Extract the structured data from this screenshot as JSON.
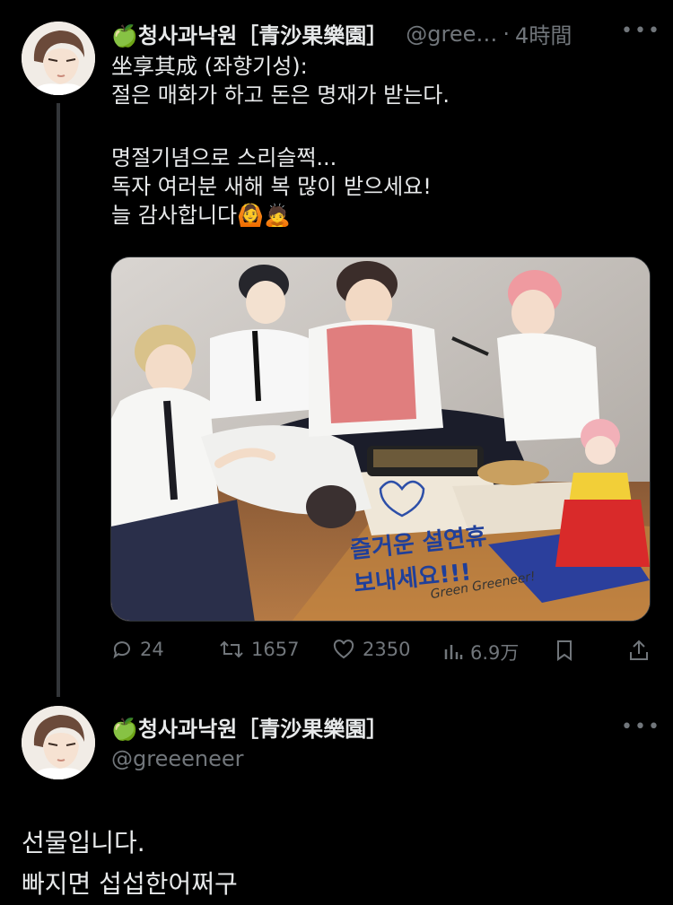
{
  "tweet": {
    "author_name": "🍏청사과낙원［青沙果樂園］",
    "handle": "@gree…",
    "separator": "·",
    "time": "4時間",
    "more": "•••",
    "lines": [
      "坐享其成 (좌향기성):",
      "절은 매화가 하고 돈은 명재가 받는다.",
      "",
      "명절기념으로 스리슬쩍...",
      "독자 여러분 새해 복 많이 받으세요!",
      "늘 감사합니다🙆🙇"
    ],
    "media": {
      "signature_lines": [
        "즐거운 설연휴",
        "보내세요!!!"
      ],
      "signature_name": "Green Greeneer!"
    },
    "actions": {
      "replies": "24",
      "retweets": "1657",
      "likes": "2350",
      "views": "6.9万"
    }
  },
  "reply": {
    "author_name": "🍏청사과낙원［青沙果樂園］",
    "handle": "@greeeneer",
    "more": "•••",
    "lines": [
      "선물입니다.",
      "빠지면 섭섭한어쩌구"
    ]
  },
  "colors": {
    "background": "#000000",
    "text": "#e7e9ea",
    "muted": "#71767b",
    "thread_line": "#333639"
  }
}
